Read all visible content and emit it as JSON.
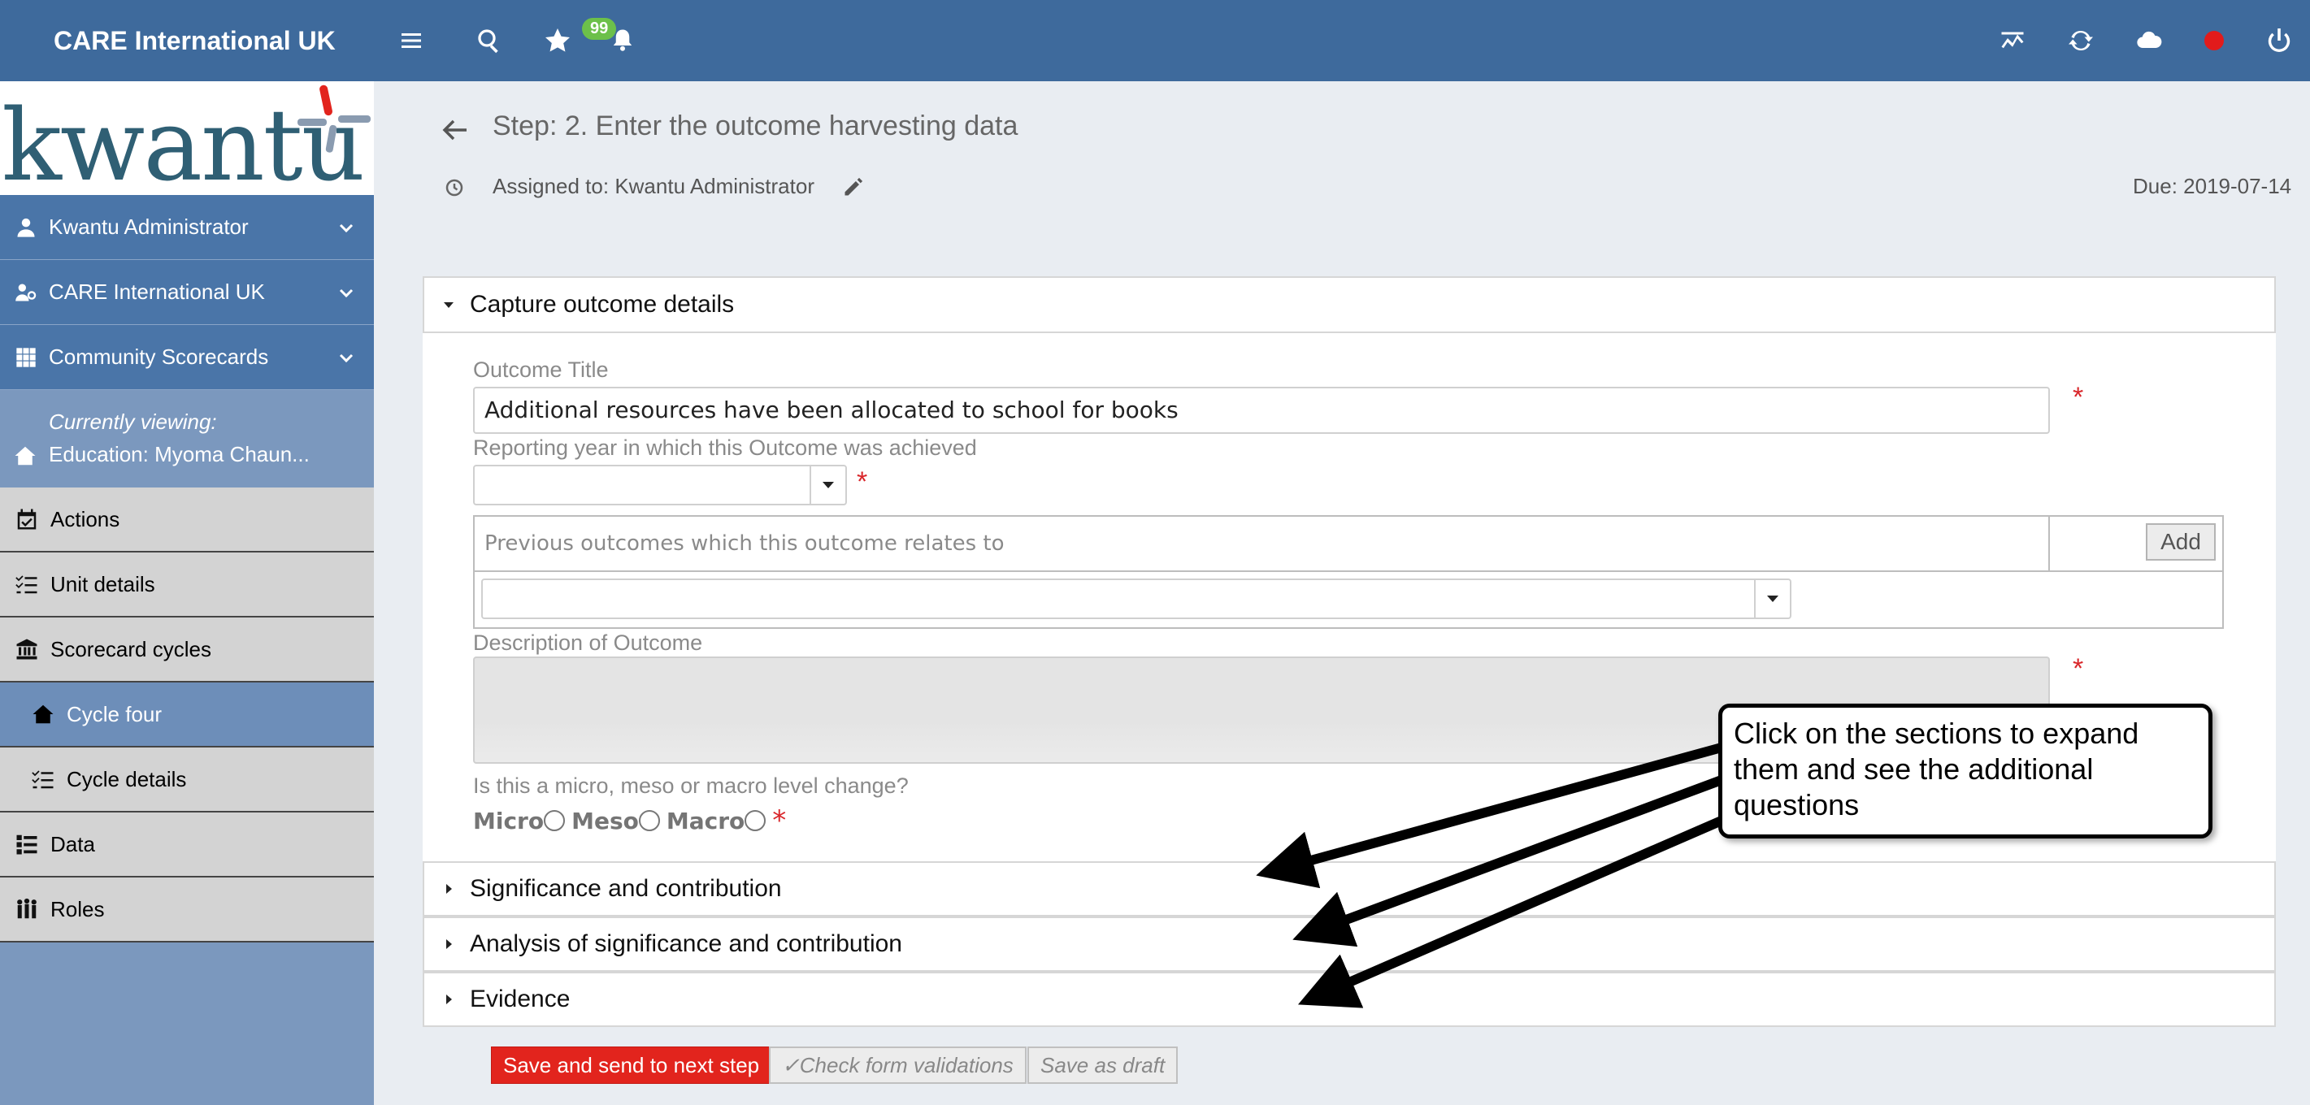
{
  "topbar": {
    "brand": "CARE International UK",
    "notification_count": "99",
    "icons": [
      "menu-icon",
      "search-icon",
      "star-icon",
      "bell-icon",
      "chart-icon",
      "sync-icon",
      "cloud-icon",
      "record-icon",
      "power-icon"
    ],
    "record_color": "#e21b1b"
  },
  "sidebar": {
    "logo_text": "kwantu",
    "user": "Kwantu Administrator",
    "org": "CARE International UK",
    "app": "Community Scorecards",
    "viewing_caption": "Currently viewing:",
    "viewing_value": "Education: Myoma Chaun...",
    "items": [
      {
        "label": "Actions",
        "icon": "calendar-check-icon"
      },
      {
        "label": "Unit details",
        "icon": "list-check-icon"
      },
      {
        "label": "Scorecard cycles",
        "icon": "building-icon"
      },
      {
        "label": "Cycle four",
        "icon": "home-icon"
      },
      {
        "label": "Cycle details",
        "icon": "list-check-icon"
      },
      {
        "label": "Data",
        "icon": "list-icon"
      },
      {
        "label": "Roles",
        "icon": "people-icon"
      }
    ]
  },
  "main": {
    "step_title": "Step: 2. Enter the outcome harvesting data",
    "assigned": "Assigned to: Kwantu Administrator",
    "due": "Due: 2019-07-14",
    "sections": [
      {
        "title": "Capture outcome details",
        "expanded": true
      },
      {
        "title": "Significance and contribution",
        "expanded": false
      },
      {
        "title": "Analysis of significance and contribution",
        "expanded": false
      },
      {
        "title": "Evidence",
        "expanded": false
      }
    ],
    "form": {
      "outcome_title_label": "Outcome Title",
      "outcome_title_value": "Additional resources have been allocated to school for books",
      "year_label": "Reporting year in which this Outcome was achieved",
      "year_value": "",
      "previous_label": "Previous outcomes which this outcome relates to",
      "add_label": "Add",
      "description_label": "Description of Outcome",
      "level_label": "Is this a micro, meso or macro level change?",
      "level_options": [
        "Micro",
        "Meso",
        "Macro"
      ],
      "required_mark": "*"
    },
    "callout": "Click on the sections to expand them and see the additional questions",
    "buttons": {
      "save_next": "Save and send to next step",
      "check": "✓Check form validations",
      "draft": "Save as draft"
    }
  }
}
